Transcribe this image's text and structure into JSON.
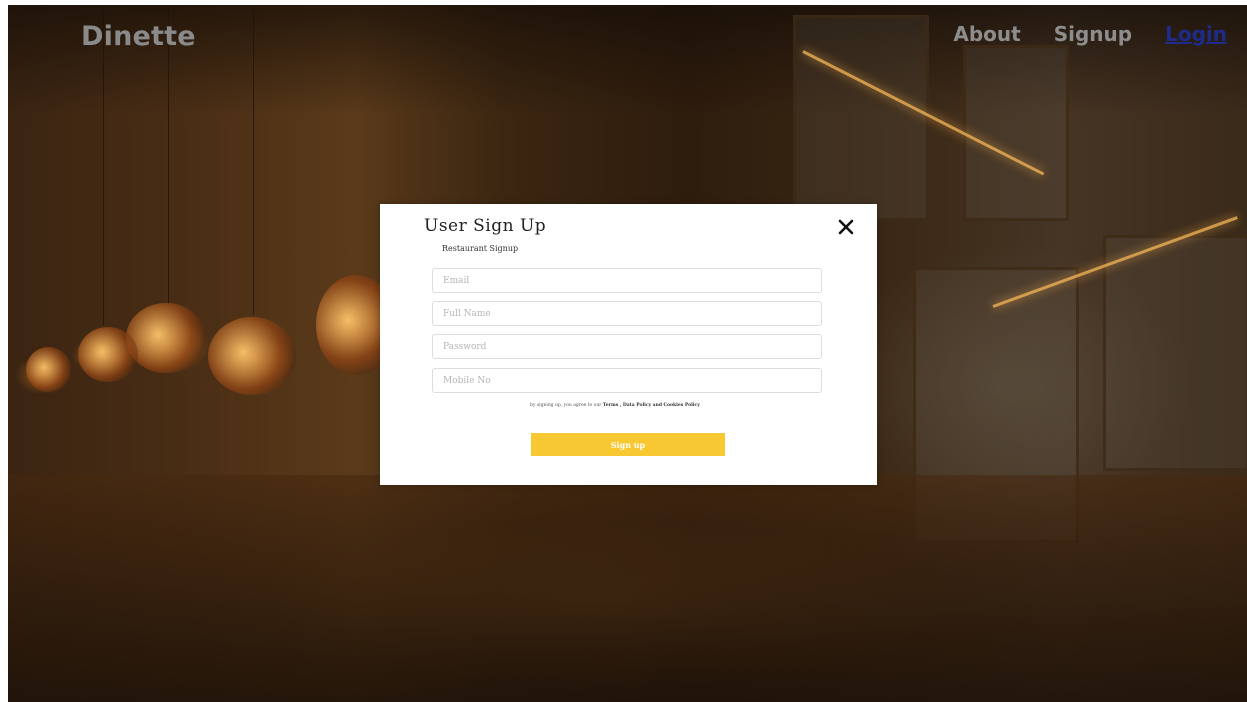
{
  "brand": {
    "name": "Dinette"
  },
  "nav": {
    "items": [
      {
        "label": "About"
      },
      {
        "label": "Signup"
      },
      {
        "label": "Login"
      }
    ],
    "active": "Login"
  },
  "modal": {
    "title": "User Sign Up",
    "subtitle": "Restaurant Signup",
    "close_icon": "close-icon",
    "fields": {
      "email": {
        "placeholder": "Email",
        "value": ""
      },
      "full_name": {
        "placeholder": "Full Name",
        "value": ""
      },
      "password": {
        "placeholder": "Password",
        "value": ""
      },
      "mobile": {
        "placeholder": "Mobile No",
        "value": ""
      }
    },
    "terms": {
      "prefix": "by signing up, you agree to our",
      "terms_link": "Terms ,",
      "data_policy_link": "Data Policy",
      "and": "and",
      "cookies_link": "Cookies Policy"
    },
    "submit_label": "Sign up"
  },
  "colors": {
    "accent": "#f7c832",
    "nav_text": "#8d8d8d",
    "nav_active": "#1e2a8c",
    "modal_bg": "#ffffff"
  }
}
